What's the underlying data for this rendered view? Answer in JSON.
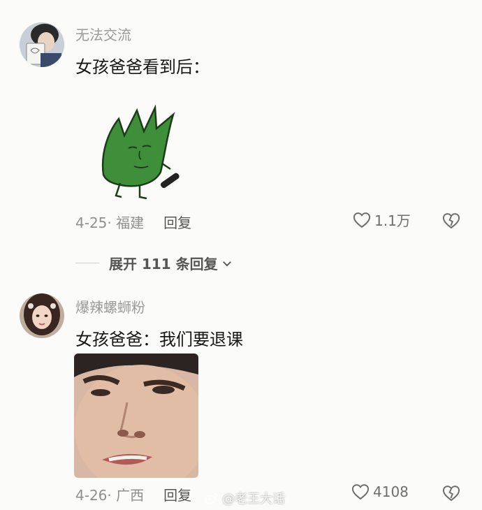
{
  "comments": [
    {
      "username": "无法交流",
      "text": "女孩爸爸看到后：",
      "date_location": "4-25· 福建",
      "reply_label": "回复",
      "likes": "1.1万",
      "sticker": "green-leaf-face-sticker",
      "expand_label": "展开 111 条回复"
    },
    {
      "username": "爆辣螺蛳粉",
      "text": "女孩爸爸：我们要退课",
      "date_location": "4-26· 广西",
      "reply_label": "回复",
      "likes": "4108",
      "sticker": "face-closeup-sticker"
    }
  ],
  "watermark": "@老王大话",
  "icons": {
    "like": "heart-outline-icon",
    "dislike": "broken-heart-icon",
    "expand": "chevron-down-icon",
    "watermark": "weibo-logo-icon"
  },
  "colors": {
    "background": "#fbfbf9",
    "username": "#9a9a9a",
    "meta": "#8f8f8f",
    "leaf_green": "#3f8f3a"
  }
}
